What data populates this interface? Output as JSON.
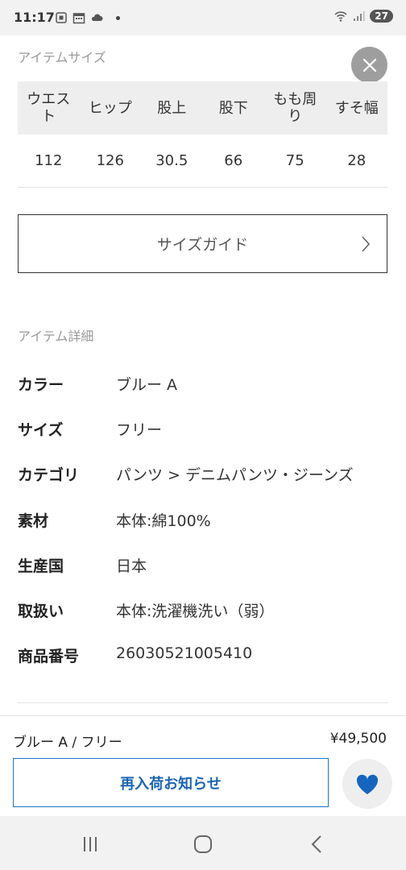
{
  "status_bar": {
    "time": "11:17",
    "battery": "27",
    "icons": [
      "screenshot-icon",
      "calendar-icon",
      "cloud-icon",
      "wifi-icon",
      "signal-icon"
    ]
  },
  "size_section": {
    "title": "アイテムサイズ",
    "headers": [
      "ウエスト",
      "ヒップ",
      "股上",
      "股下",
      "もも周り",
      "すそ幅"
    ],
    "values": [
      "112",
      "126",
      "30.5",
      "66",
      "75",
      "28"
    ]
  },
  "size_guide": {
    "label": "サイズガイド"
  },
  "details_section": {
    "title": "アイテム詳細",
    "rows": [
      {
        "key": "カラー",
        "value": "ブルー A"
      },
      {
        "key": "サイズ",
        "value": "フリー"
      },
      {
        "key": "カテゴリ",
        "value": "パンツ > デニムパンツ・ジーンズ"
      },
      {
        "key": "素材",
        "value": "本体:綿100%"
      },
      {
        "key": "生産国",
        "value": "日本"
      },
      {
        "key": "取扱い",
        "value": "本体:洗濯機洗い（弱）"
      },
      {
        "key": "商品番号",
        "value": "26030521005410"
      }
    ]
  },
  "bottom_bar": {
    "selection": "ブルー A / フリー",
    "price": "¥49,500",
    "restock_button": "再入荷お知らせ"
  },
  "colors": {
    "accent_blue": "#1a64b4",
    "heart_blue": "#1565c0",
    "close_gray": "#9e9e9e"
  }
}
